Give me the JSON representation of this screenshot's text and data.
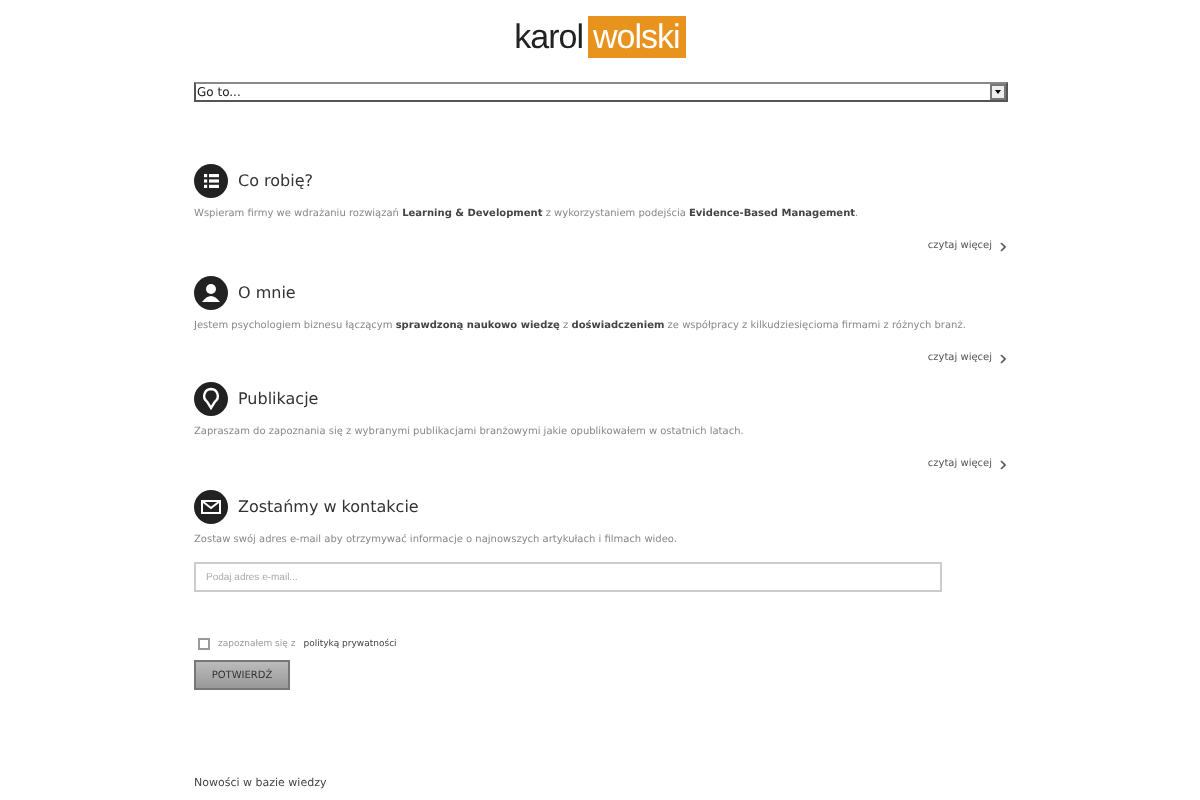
{
  "logo": {
    "first": "karol",
    "second": "wolski"
  },
  "nav": {
    "value": "Go to..."
  },
  "sections": [
    {
      "title": "Co robię?",
      "text": "Wspieram firmy we wdrażaniu rozwiązań **Learning & Development** z wykorzystaniem podejścia **Evidence-Based Management**.",
      "more": "czytaj więcej"
    },
    {
      "title": "O mnie",
      "text": "Jestem psychologiem biznesu łączącym **sprawdzoną naukowo wiedzę** z **doświadczeniem** ze współpracy z kilkudziesięcioma firmami z różnych branż.",
      "more": "czytaj więcej"
    },
    {
      "title": "Publikacje",
      "text": "Zapraszam do zapoznania się z wybranymi publikacjami branżowymi jakie opublikowałem w ostatnich latach.",
      "more": "czytaj więcej"
    }
  ],
  "contact": {
    "title": "Zostańmy w kontakcie",
    "text": "Zostaw swój adres e-mail aby otrzymywać informacje o najnowszych artykułach i filmach wideo.",
    "placeholder": "Podaj adres e-mail...",
    "consent": {
      "text": "zapoznałem się z",
      "link": "polityką prywatności",
      "checked": false
    },
    "submit": "POTWIERDŹ"
  },
  "footer_heading": "Nowości w bazie wiedzy"
}
